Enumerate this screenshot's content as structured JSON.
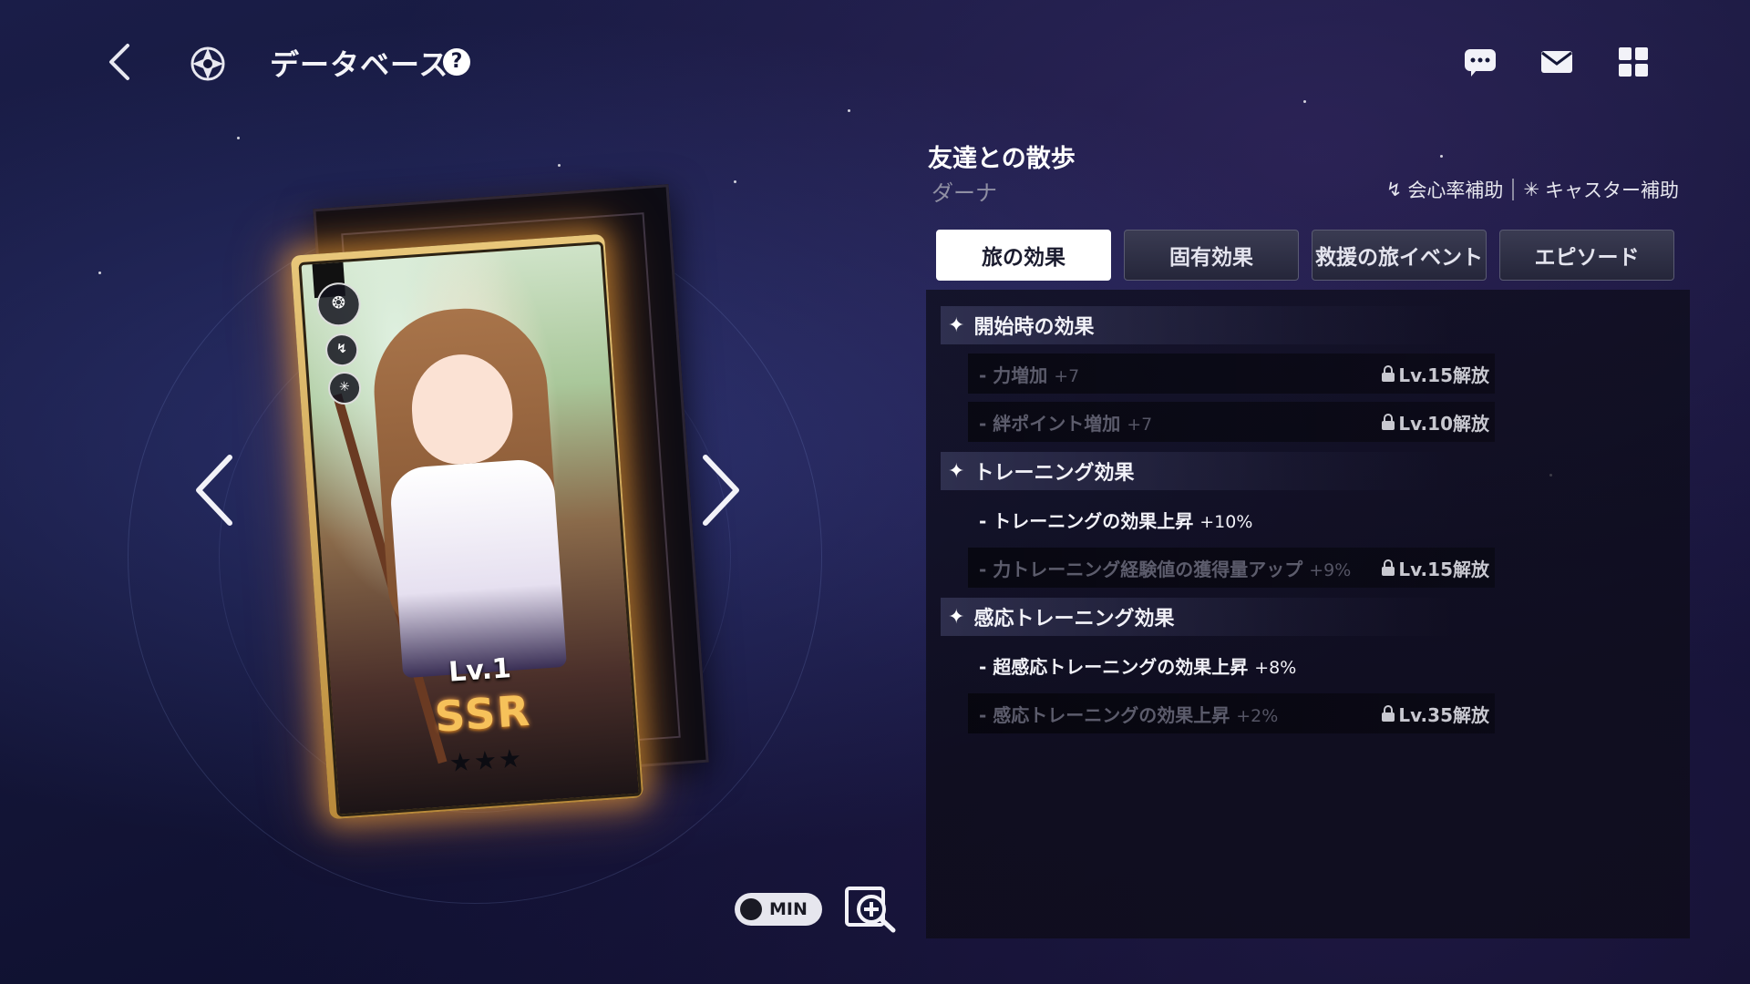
{
  "header": {
    "title": "データベース",
    "help_label": "?"
  },
  "card": {
    "level": "Lv.1",
    "rarity": "SSR",
    "stars": "★★★"
  },
  "controls": {
    "toggle_label": "MIN"
  },
  "detail": {
    "title": "友達との散歩",
    "character": "ダーナ",
    "tags": [
      "会心率補助",
      "キャスター補助"
    ],
    "tabs": [
      {
        "label": "旅の効果",
        "active": true
      },
      {
        "label": "固有効果",
        "active": false
      },
      {
        "label": "救援の旅イベント",
        "active": false
      },
      {
        "label": "エピソード",
        "active": false
      }
    ],
    "sections": [
      {
        "title": "開始時の効果",
        "effects": [
          {
            "name": "力増加",
            "value": "+7",
            "lock": "Lv.15解放"
          },
          {
            "name": "絆ポイント増加",
            "value": "+7",
            "lock": "Lv.10解放"
          }
        ]
      },
      {
        "title": "トレーニング効果",
        "effects": [
          {
            "name": "トレーニングの効果上昇",
            "value": "+10%",
            "lock": ""
          },
          {
            "name": "力トレーニング経験値の獲得量アップ",
            "value": "+9%",
            "lock": "Lv.15解放"
          }
        ]
      },
      {
        "title": "感応トレーニング効果",
        "effects": [
          {
            "name": "超感応トレーニングの効果上昇",
            "value": "+8%",
            "lock": ""
          },
          {
            "name": "感応トレーニングの効果上昇",
            "value": "+2%",
            "lock": "Lv.35解放"
          }
        ]
      }
    ]
  },
  "colors": {
    "background": "#141638",
    "card_glow": "#ffaa3c",
    "rarity": "#f6c15a",
    "active_tab": "#ffffff"
  }
}
